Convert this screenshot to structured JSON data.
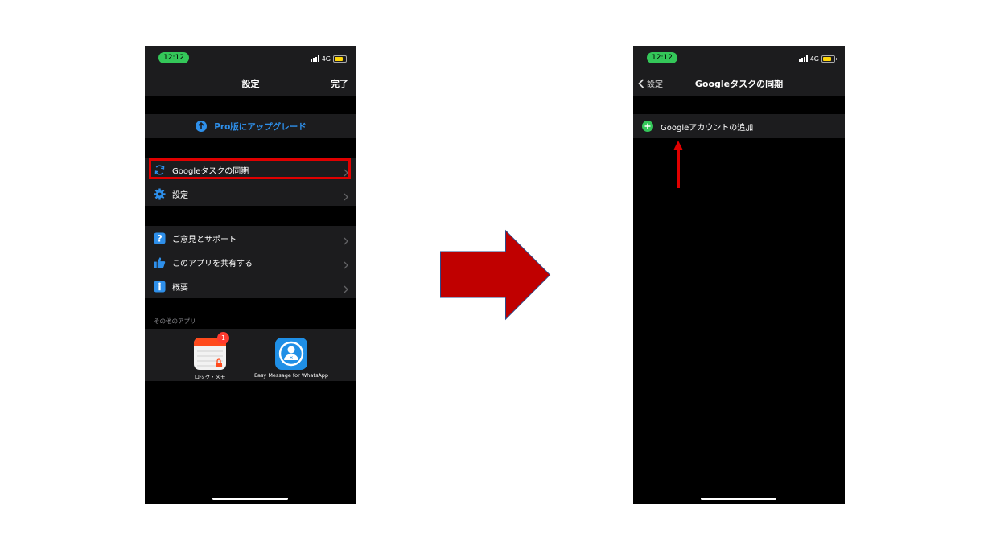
{
  "left_screen": {
    "status": {
      "time": "12:12",
      "network": "4G"
    },
    "nav": {
      "title": "設定",
      "done": "完了"
    },
    "upgrade_label": "Pro版にアップグレード",
    "group1": [
      {
        "label": "Googleタスクの同期",
        "icon": "sync-icon"
      },
      {
        "label": "設定",
        "icon": "gear-icon"
      }
    ],
    "group2": [
      {
        "label": "ご意見とサポート",
        "icon": "help-icon"
      },
      {
        "label": "このアプリを共有する",
        "icon": "thumbs-up-icon"
      },
      {
        "label": "概要",
        "icon": "info-icon"
      }
    ],
    "other_apps_header": "その他のアプリ",
    "apps": [
      {
        "name": "ロック・メモ",
        "badge": "1"
      },
      {
        "name": "Easy Message for WhatsApp"
      }
    ]
  },
  "right_screen": {
    "status": {
      "time": "12:12",
      "network": "4G"
    },
    "nav": {
      "back": "設定",
      "title": "Googleタスクの同期"
    },
    "add_account_label": "Googleアカウントの追加"
  },
  "colors": {
    "accent_blue": "#2e8fea",
    "highlight_red": "#e00000",
    "arrow_red": "#c00000",
    "green": "#34c759"
  }
}
